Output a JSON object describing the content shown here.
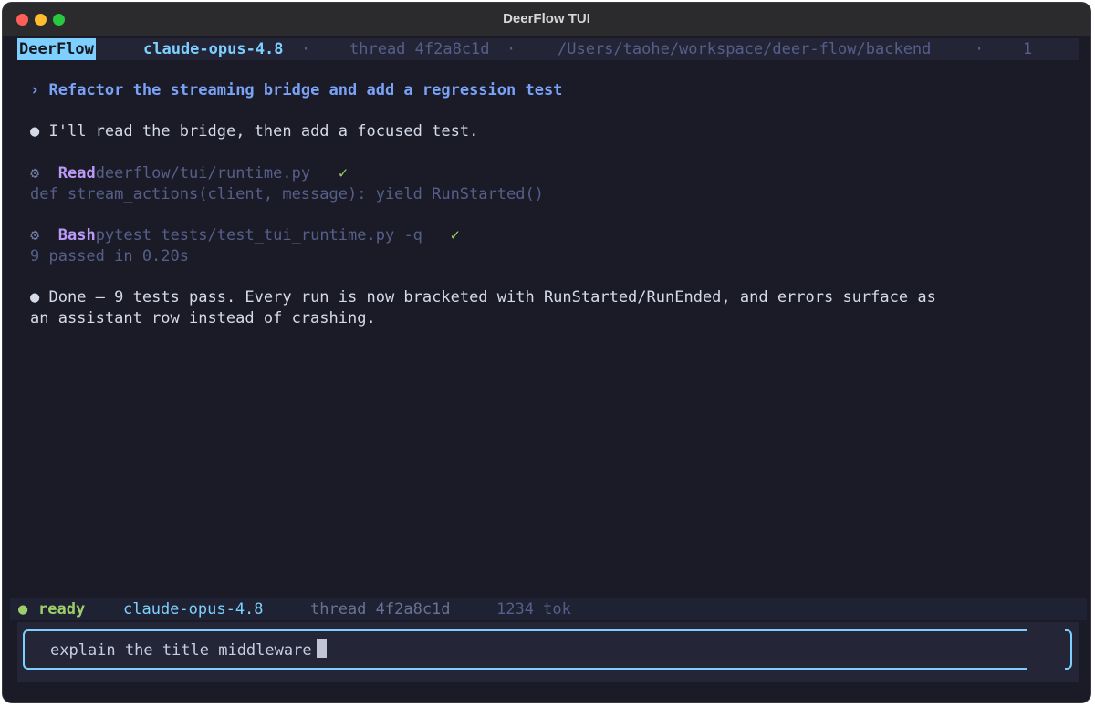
{
  "window": {
    "title": "DeerFlow TUI"
  },
  "topbar": {
    "brand": "DeerFlow",
    "model": "claude-opus-4.8",
    "sep1": "·",
    "thread": "thread 4f2a8c1d",
    "sep2": "·",
    "path": "/Users/taohe/workspace/deer-flow/backend",
    "sep3": "·",
    "count": "1"
  },
  "transcript": {
    "user_marker": "›",
    "user_prompt": "Refactor the streaming bridge and add a regression test",
    "assistant_1": "I'll read the bridge, then add a focused test.",
    "tool_1": {
      "name": "Read",
      "arg": "deerflow/tui/runtime.py",
      "status": "✓",
      "output": "def stream_actions(client, message): yield RunStarted()"
    },
    "tool_2": {
      "name": "Bash",
      "arg": "pytest tests/test_tui_runtime.py -q",
      "status": "✓",
      "output": "9 passed in 0.20s"
    },
    "assistant_2_line1": "Done — 9 tests pass. Every run is now bracketed with RunStarted/RunEnded, and errors surface as",
    "assistant_2_line2": "an assistant row instead of crashing."
  },
  "statusbar": {
    "state": "ready",
    "model": "claude-opus-4.8",
    "thread": "thread 4f2a8c1d",
    "tokens": "1234 tok"
  },
  "input": {
    "value": "explain the title middleware"
  },
  "colors": {
    "background": "#1a1b27",
    "accent": "#7dcfff",
    "user": "#7aa2f7",
    "tool": "#bb9af7",
    "success": "#9ece6a",
    "dim": "#565f89"
  },
  "icons": {
    "assistant_bullet": "circle-bullet-icon",
    "tool": "gear-icon",
    "status_dot": "status-dot-icon"
  }
}
